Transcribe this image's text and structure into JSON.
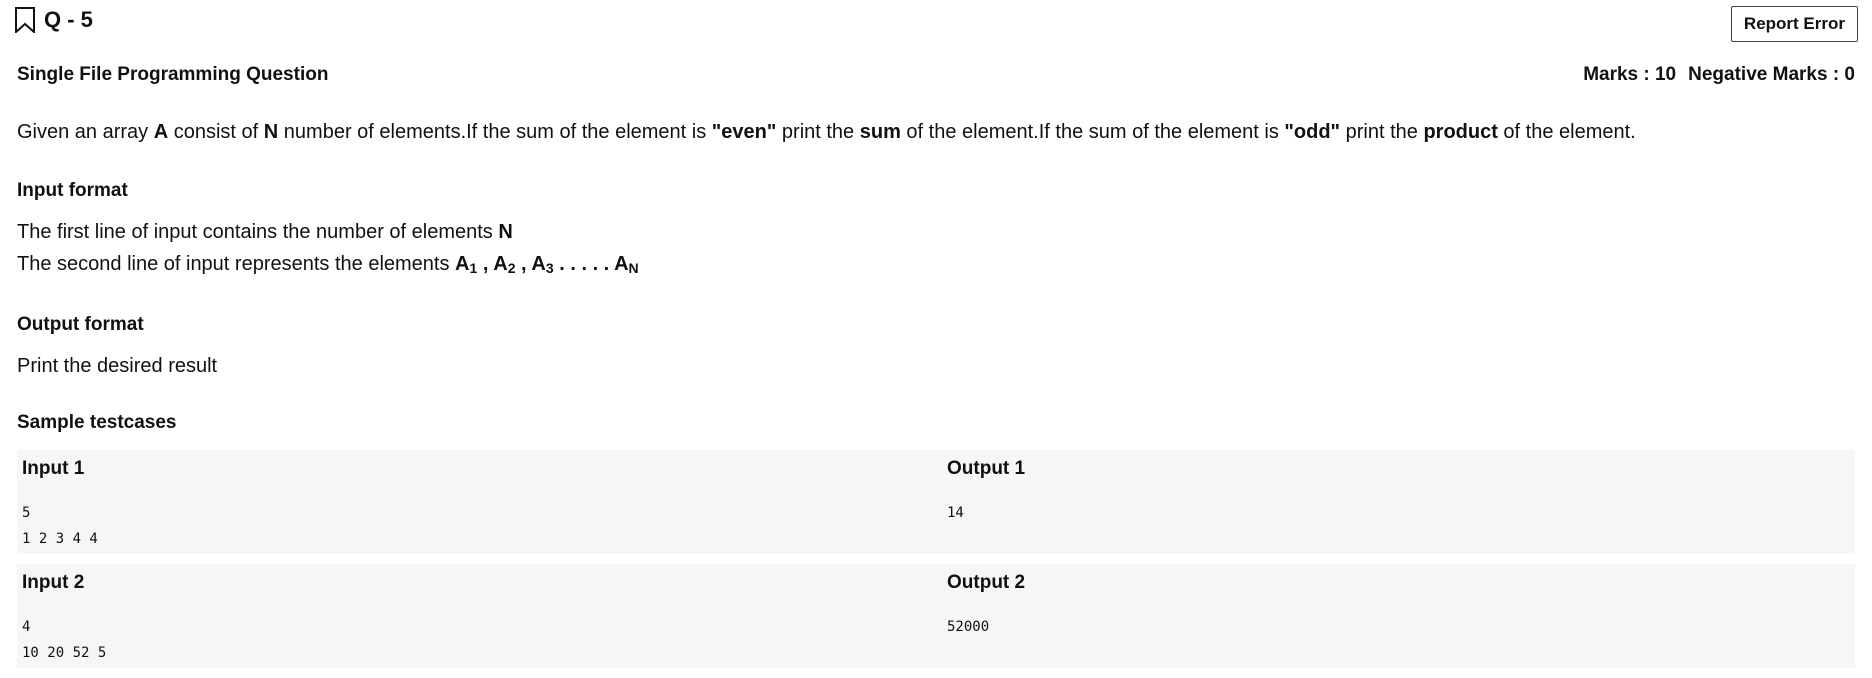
{
  "header": {
    "question_label": "Q - 5",
    "report_button": "Report Error",
    "icons": {
      "bookmark": "bookmark-outline-icon"
    }
  },
  "meta": {
    "question_type": "Single File Programming Question",
    "marks": "Marks : 10",
    "negative_marks": "Negative Marks : 0"
  },
  "problem": {
    "p1": "Given an array ",
    "b1": "A",
    "p2": " consist of ",
    "b2": "N",
    "p3": " number of elements.If the sum of the element is ",
    "b3": "\"even\"",
    "p4": " print the ",
    "b4": "sum",
    "p5": " of the element.If the sum of the element is ",
    "b5": "\"odd\"",
    "p6": " print the ",
    "b6": "product",
    "p7": " of the element."
  },
  "input_format": {
    "heading": "Input format",
    "line1_text": "The first line of input contains the number of elements ",
    "line1_bold": "N",
    "line2_text": "The second line of input represents the elements ",
    "a1": "A",
    "s1": "1",
    "sep1": " , ",
    "a2": "A",
    "s2": "2",
    "sep2": " , ",
    "a3": "A",
    "s3": "3",
    "dots": " . . . . . ",
    "an": "A",
    "sn": "N"
  },
  "output_format": {
    "heading": "Output format",
    "text": "Print the desired result"
  },
  "samples": {
    "heading": "Sample testcases",
    "cases": [
      {
        "input_label": "Input 1",
        "input": "5\n1 2 3 4 4",
        "output_label": "Output 1",
        "output": "14"
      },
      {
        "input_label": "Input 2",
        "input": "4\n10 20 52 5",
        "output_label": "Output 2",
        "output": "52000"
      }
    ]
  }
}
